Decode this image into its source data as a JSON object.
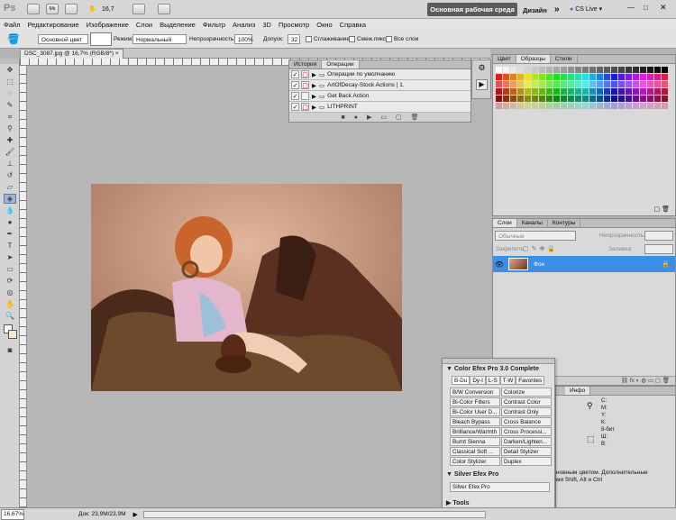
{
  "app": {
    "logo": "Ps",
    "zoom": "16,7"
  },
  "workspace": {
    "essentials": "Основная рабочая среда",
    "design": "Дизайн",
    "more": "»",
    "cslive": "CS Live"
  },
  "menu": [
    "Файл",
    "Редактирование",
    "Изображение",
    "Слои",
    "Выделение",
    "Фильтр",
    "Анализ",
    "3D",
    "Просмотр",
    "Окно",
    "Справка"
  ],
  "options": {
    "preset": "Основной цвет",
    "mode_label": "Режим:",
    "mode_value": "Нормальный",
    "opacity_label": "Непрозрачность:",
    "opacity_value": "100%",
    "tolerance_label": "Допуск:",
    "tolerance_value": "32",
    "antialias": "Сглаживание",
    "contiguous": "Смеж.пикс",
    "all_layers": "Все слои"
  },
  "document": {
    "tab": "DSC_3087.jpg @ 16,7% (RGB/8*)",
    "close": "×"
  },
  "status": {
    "zoom": "16,67%",
    "doc": "Док: 23,9M/23,9M"
  },
  "actions_panel": {
    "tabs": [
      "История",
      "Операции"
    ],
    "rows": [
      "Операции по умолчанию",
      "ArtOfDecay-Stock Actions | 1.",
      "Get Back Action",
      "LITHPRINT"
    ]
  },
  "swatches_panel": {
    "tabs": [
      "Цвет",
      "Образцы",
      "Стили"
    ]
  },
  "layers_panel": {
    "tabs": [
      "Слои",
      "Каналы",
      "Контуры"
    ],
    "blend": "Обычные",
    "opacity_label": "Непрозрачность:",
    "lock_label": "Закрепить:",
    "fill_label": "Заливка:",
    "layer_name": "Фон"
  },
  "efex": {
    "title": "Color Efex Pro 3.0 Complete",
    "tabs": [
      "B-Du",
      "Dy-I",
      "L-S",
      "T-W",
      "Favorites"
    ],
    "filters": [
      "B/W Conversion",
      "Colorize",
      "Bi-Color Filters",
      "Contrast Color",
      "Bi-Color User D...",
      "Contrast Only",
      "Bleach Bypass",
      "Cross Balance",
      "Brilliance/Warmth",
      "Cross Processi...",
      "Burnt Sienna",
      "Darken/Lighten...",
      "Classical Soft ...",
      "Detail Stylizer",
      "Color Stylizer",
      "Duplex"
    ],
    "silver_title": "Silver Efex Pro",
    "silver_btn": "Silver Efex Pro",
    "tools": "Tools"
  },
  "info_panel": {
    "tab": "Инфо",
    "labels": [
      "C:",
      "M:",
      "Y:",
      "K:",
      "8-бит",
      "Ш:",
      "В:"
    ],
    "hint1": "новным цветом. Дополнительные",
    "hint2": "ми Shift, Alt и Ctrl"
  },
  "colors": {
    "accent": "#3f86d6",
    "selected_layer": "#3b8fe6"
  }
}
